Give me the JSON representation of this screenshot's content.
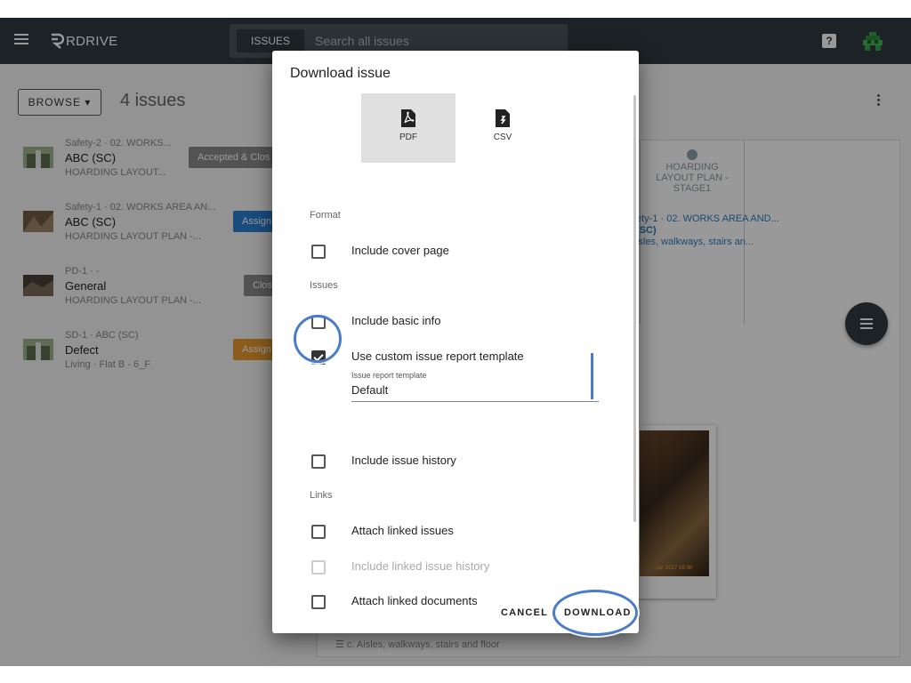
{
  "topbar": {
    "logo": "RDRIVE",
    "search_tab": "ISSUES",
    "search_placeholder": "Search all issues",
    "help_glyph": "?"
  },
  "toolbar": {
    "browse_label": "BROWSE ▾",
    "count_label": "4 issues"
  },
  "issues": [
    {
      "line1": "Safety-2 · 02. WORKS...",
      "line2": "ABC (SC)",
      "line3": "HOARDING LAYOUT...",
      "badge": "Accepted & Clos",
      "badge_color": "#8a8a8a"
    },
    {
      "line1": "Safety-1 · 02. WORKS AREA AN...",
      "line2": "ABC (SC)",
      "line3": "HOARDING LAYOUT PLAN -...",
      "badge": "Assign",
      "badge_color": "#2a7fd4"
    },
    {
      "line1": "PD-1 · -",
      "line2": "General",
      "line3": "HOARDING LAYOUT PLAN -...",
      "badge": "Clos",
      "badge_color": "#8a8a8a"
    },
    {
      "line1": "SD-1 · ABC (SC)",
      "line2": "Defect",
      "line3": "Living · Flat B - 6_F",
      "badge": "Assign",
      "badge_color": "#e89a2c"
    }
  ],
  "detail": {
    "plan_title": "HOARDING LAYOUT PLAN - STAGE1",
    "text1": "ety-1 · 02. WORKS AREA AND...",
    "text2": "(SC)",
    "text3": "isles, walkways, stairs an...",
    "photo_stamp": "Apr 2017 16:38",
    "footer": "c. Aisles, walkways, stairs and floor"
  },
  "dialog": {
    "title": "Download issue",
    "formats": [
      {
        "label": "PDF",
        "icon": "pdf-file-icon",
        "selected": true
      },
      {
        "label": "CSV",
        "icon": "csv-file-icon",
        "selected": false
      }
    ],
    "sections": {
      "format": "Format",
      "issues": "Issues",
      "links": "Links"
    },
    "options": {
      "cover_page": "Include cover page",
      "basic_info": "Include basic info",
      "custom_template": "Use custom issue report template",
      "issue_history": "Include issue history",
      "attach_linked_issues": "Attach linked issues",
      "linked_issue_history": "Include linked issue history",
      "attach_linked_documents": "Attach linked documents"
    },
    "template_field": {
      "label": "Issue report template",
      "value": "Default"
    },
    "cancel_label": "CANCEL",
    "download_label": "DOWNLOAD"
  },
  "colors": {
    "topbar": "#2f3a3f",
    "highlight": "#4a7cc9",
    "link_blue": "#2b7bc4"
  }
}
